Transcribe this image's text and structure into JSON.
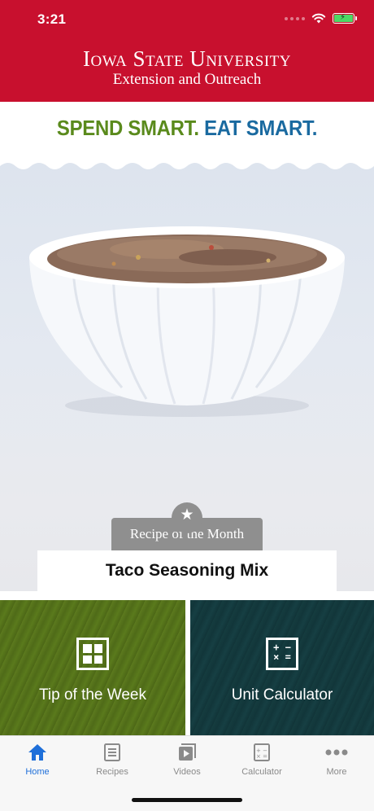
{
  "status_bar": {
    "time": "3:21"
  },
  "header": {
    "title": "Iowa State University",
    "subtitle": "Extension and Outreach"
  },
  "tagline": {
    "part_a": "SPEND SMART.",
    "part_b": "EAT SMART."
  },
  "featured": {
    "badge": "Recipe of the Month",
    "title": "Taco Seasoning Mix",
    "image_icon": "spice-bowl-photo"
  },
  "tiles": [
    {
      "label": "Tip of the Week",
      "icon": "tip-grid-icon",
      "color": "#567320"
    },
    {
      "label": "Unit Calculator",
      "icon": "calculator-icon",
      "color": "#153a3d"
    }
  ],
  "tabbar": {
    "items": [
      {
        "label": "Home",
        "icon": "home-icon",
        "active": true
      },
      {
        "label": "Recipes",
        "icon": "recipes-icon",
        "active": false
      },
      {
        "label": "Videos",
        "icon": "videos-icon",
        "active": false
      },
      {
        "label": "Calculator",
        "icon": "calculator-icon",
        "active": false
      },
      {
        "label": "More",
        "icon": "more-icon",
        "active": false
      }
    ]
  },
  "colors": {
    "header": "#c8102e",
    "accent": "#1e6fd9",
    "tag_green": "#5a8a1c",
    "tag_blue": "#1a6aa0"
  }
}
